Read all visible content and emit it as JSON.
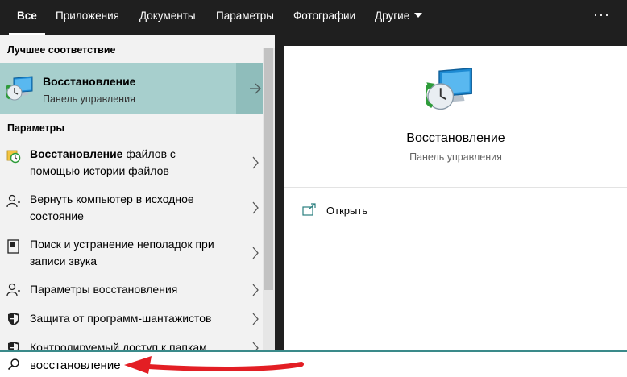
{
  "tabs": [
    {
      "label": "Все",
      "active": true
    },
    {
      "label": "Приложения",
      "active": false
    },
    {
      "label": "Документы",
      "active": false
    },
    {
      "label": "Параметры",
      "active": false
    },
    {
      "label": "Фотографии",
      "active": false
    },
    {
      "label": "Другие",
      "active": false
    }
  ],
  "more_label": "···",
  "best_match": {
    "section_title": "Лучшее соответствие",
    "title": "Восстановление",
    "subtitle": "Панель управления",
    "icon": "recovery-computer-icon"
  },
  "settings": {
    "section_title": "Параметры",
    "items": [
      {
        "bold": "Восстановление",
        "rest": " файлов с",
        "line2": "помощью истории файлов",
        "icon": "file-history-icon"
      },
      {
        "line1": "Вернуть компьютер в исходное",
        "line2": "состояние",
        "icon": "reset-pc-icon"
      },
      {
        "line1": "Поиск и устранение неполадок при",
        "line2": "записи звука",
        "icon": "troubleshoot-icon"
      },
      {
        "line1": "Параметры восстановления",
        "icon": "recovery-settings-icon"
      },
      {
        "line1": "Защита от программ-шантажистов",
        "icon": "shield-icon"
      },
      {
        "line1": "Контролируемый доступ к папкам",
        "icon": "shield-icon"
      }
    ]
  },
  "preview": {
    "title": "Восстановление",
    "subtitle": "Панель управления",
    "open_label": "Открыть"
  },
  "search": {
    "value": "восстановление"
  },
  "colors": {
    "best_match_bg": "#a7cfcd",
    "search_border": "#3a8a8a",
    "annotation_arrow": "#e31e24"
  }
}
